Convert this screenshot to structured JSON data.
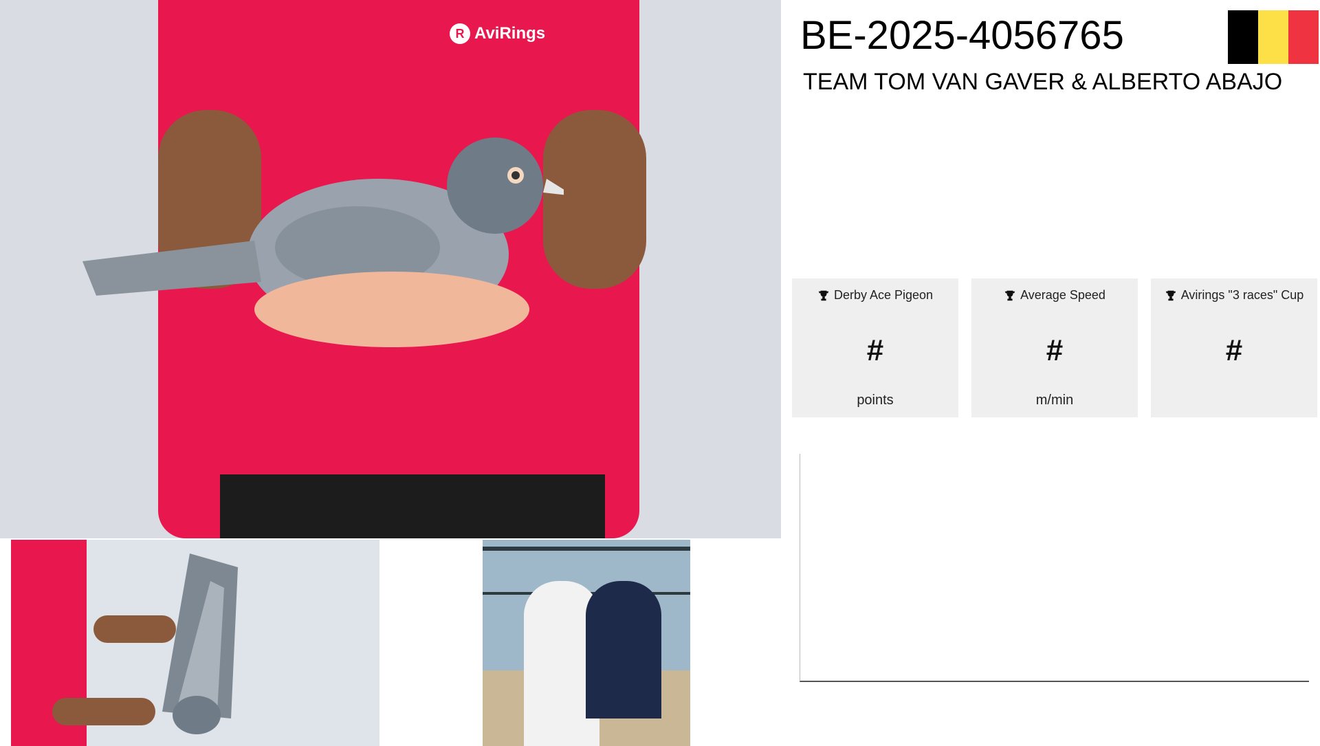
{
  "header": {
    "ring_number": "BE-2025-4056765",
    "team_name": "TEAM TOM VAN GAVER & ALBERTO ABAJO",
    "flag_colors": [
      "#000000",
      "#fde047",
      "#ef3340"
    ]
  },
  "photos": {
    "main_logo_text": "AviRings",
    "main_logo_letter": "R"
  },
  "stats": [
    {
      "title": "Derby Ace Pigeon",
      "value": "#",
      "unit": "points",
      "icon": "trophy-icon"
    },
    {
      "title": "Average Speed",
      "value": "#",
      "unit": "m/min",
      "icon": "trophy-icon"
    },
    {
      "title": "Avirings \"3 races\" Cup",
      "value": "#",
      "unit": "",
      "icon": "trophy-icon"
    }
  ]
}
